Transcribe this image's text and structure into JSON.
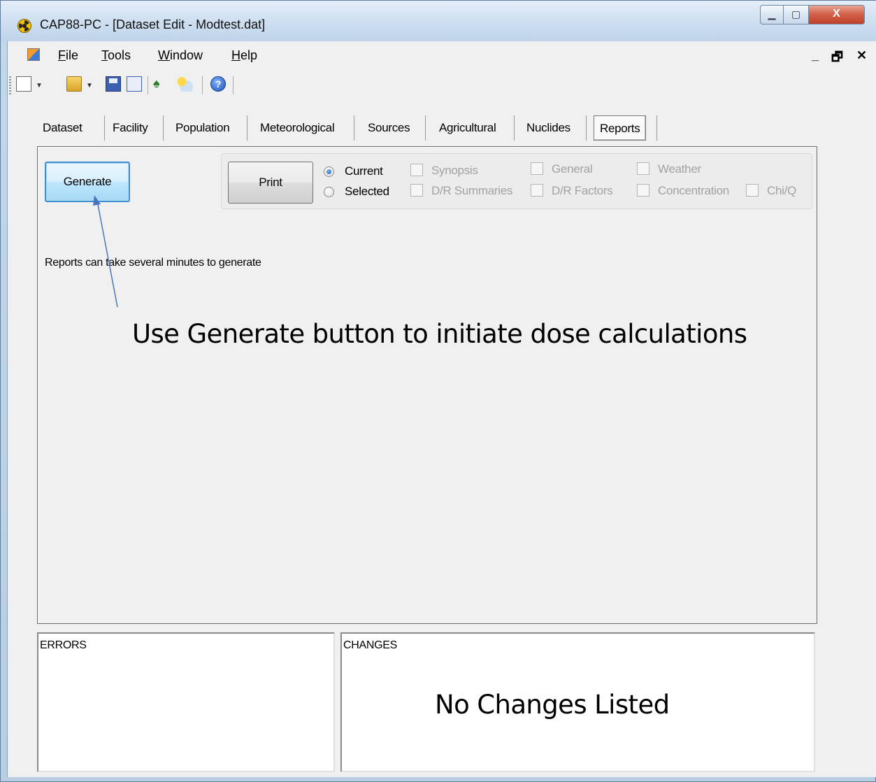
{
  "window": {
    "title": "CAP88-PC - [Dataset Edit - Modtest.dat]",
    "controls": {
      "minimize": "▁",
      "maximize": "▢",
      "close": "X"
    }
  },
  "menubar": {
    "items": [
      {
        "label": "File",
        "accel": "F",
        "rest": "ile"
      },
      {
        "label": "Tools",
        "accel": "T",
        "rest": "ools"
      },
      {
        "label": "Window",
        "accel": "W",
        "rest": "indow"
      },
      {
        "label": "Help",
        "accel": "H",
        "rest": "elp"
      }
    ],
    "mdi_controls": {
      "minimize": "_",
      "restore": "🗗",
      "close": "✕"
    }
  },
  "toolbar": {
    "icons": [
      "new-document-icon",
      "open-folder-icon",
      "save-icon",
      "save-as-icon",
      "find-icon",
      "weather-icon",
      "help-icon"
    ],
    "help_glyph": "?"
  },
  "tabs": [
    {
      "label": "Dataset",
      "active": false
    },
    {
      "label": "Facility",
      "active": false
    },
    {
      "label": "Population",
      "active": false
    },
    {
      "label": "Meteorological",
      "active": false
    },
    {
      "label": "Sources",
      "active": false
    },
    {
      "label": "Agricultural",
      "active": false
    },
    {
      "label": "Nuclides",
      "active": false
    },
    {
      "label": "Reports",
      "active": true
    }
  ],
  "reports": {
    "generate_label": "Generate",
    "print_label": "Print",
    "radios": [
      {
        "label": "Current",
        "checked": true
      },
      {
        "label": "Selected",
        "checked": false
      }
    ],
    "checkboxes": [
      {
        "label": "Synopsis",
        "checked": false,
        "enabled": false
      },
      {
        "label": "General",
        "checked": false,
        "enabled": false
      },
      {
        "label": "Weather",
        "checked": false,
        "enabled": false
      },
      {
        "label": "D/R Summaries",
        "checked": false,
        "enabled": false
      },
      {
        "label": "D/R Factors",
        "checked": false,
        "enabled": false
      },
      {
        "label": "Concentration",
        "checked": false,
        "enabled": false
      },
      {
        "label": "Chi/Q",
        "checked": false,
        "enabled": false
      }
    ],
    "note": "Reports can take several minutes to generate"
  },
  "annotation": {
    "text": "Use Generate button to initiate dose calculations",
    "arrow_color": "#4a76b8"
  },
  "errors": {
    "title": "ERRORS"
  },
  "changes": {
    "title": "CHANGES",
    "message": "No Changes Listed"
  },
  "colors": {
    "accent": "#3c8fd0",
    "disabled_text": "#a2a2a2",
    "close_button": "#c0402a"
  }
}
